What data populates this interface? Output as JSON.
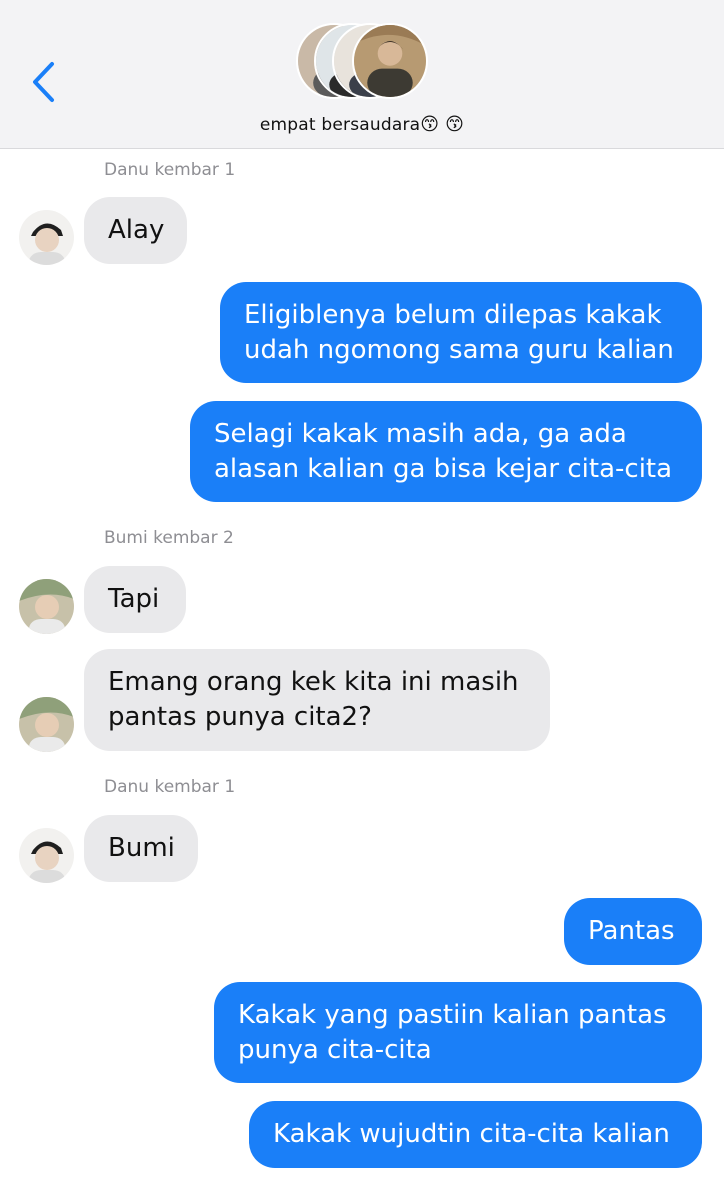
{
  "header": {
    "title": "empat bersaudara",
    "title_emojis": "😙 😙",
    "back_icon": "chevron-left-icon",
    "accent_color": "#1a7ff8"
  },
  "messages": [
    {
      "type": "sender",
      "text": "Danu kembar 1"
    },
    {
      "type": "incoming",
      "avatar": "danu",
      "text": "Alay"
    },
    {
      "type": "outgoing",
      "text": "Eligiblenya belum dilepas kakak\nudah ngomong sama guru kalian"
    },
    {
      "type": "outgoing",
      "text": "Selagi kakak masih ada, ga ada\nalasan kalian ga bisa kejar cita-cita"
    },
    {
      "type": "sender",
      "text": "Bumi kembar 2"
    },
    {
      "type": "incoming",
      "avatar": "bumi",
      "text": "Tapi"
    },
    {
      "type": "incoming",
      "avatar": "bumi",
      "text": "Emang orang kek kita ini masih\npantas punya cita2?"
    },
    {
      "type": "sender",
      "text": "Danu kembar 1"
    },
    {
      "type": "incoming",
      "avatar": "danu",
      "text": "Bumi"
    },
    {
      "type": "outgoing",
      "text": "Pantas"
    },
    {
      "type": "outgoing",
      "text": "Kakak yang pastiin kalian pantas\npunya cita-cita"
    },
    {
      "type": "outgoing",
      "text": "Kakak wujudtin cita-cita kalian"
    }
  ]
}
